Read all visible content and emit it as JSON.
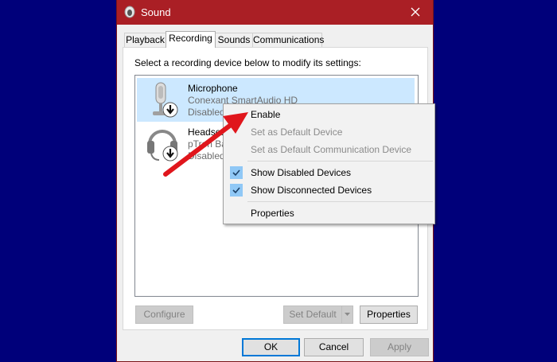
{
  "window": {
    "title": "Sound",
    "icon": "speaker-icon",
    "close_icon": "close-icon",
    "title_color": "#aa1f25"
  },
  "tabs": [
    {
      "label": "Playback",
      "active": false
    },
    {
      "label": "Recording",
      "active": true
    },
    {
      "label": "Sounds",
      "active": false
    },
    {
      "label": "Communications",
      "active": false
    }
  ],
  "instruction": "Select a recording device below to modify its settings:",
  "devices": [
    {
      "name": "Microphone",
      "description": "Conexant SmartAudio HD",
      "status": "Disabled",
      "icon": "microphone-icon",
      "badge": "disabled-down-arrow-icon",
      "selected": true
    },
    {
      "name": "Headset",
      "description": "pTron Ba",
      "status": "Disabled",
      "icon": "headset-icon",
      "badge": "disabled-down-arrow-icon",
      "selected": false
    }
  ],
  "context_menu": {
    "items": [
      {
        "label": "Enable",
        "enabled": true,
        "checked": false
      },
      {
        "label": "Set as Default Device",
        "enabled": false,
        "checked": false
      },
      {
        "label": "Set as Default Communication Device",
        "enabled": false,
        "checked": false
      },
      {
        "label": "Show Disabled Devices",
        "enabled": true,
        "checked": true
      },
      {
        "label": "Show Disconnected Devices",
        "enabled": true,
        "checked": true
      },
      {
        "label": "Properties",
        "enabled": true,
        "checked": false
      }
    ]
  },
  "buttons": {
    "configure": "Configure",
    "set_default": "Set Default",
    "properties": "Properties",
    "ok": "OK",
    "cancel": "Cancel",
    "apply": "Apply"
  },
  "annotation": {
    "arrow_color": "#e0161c"
  }
}
